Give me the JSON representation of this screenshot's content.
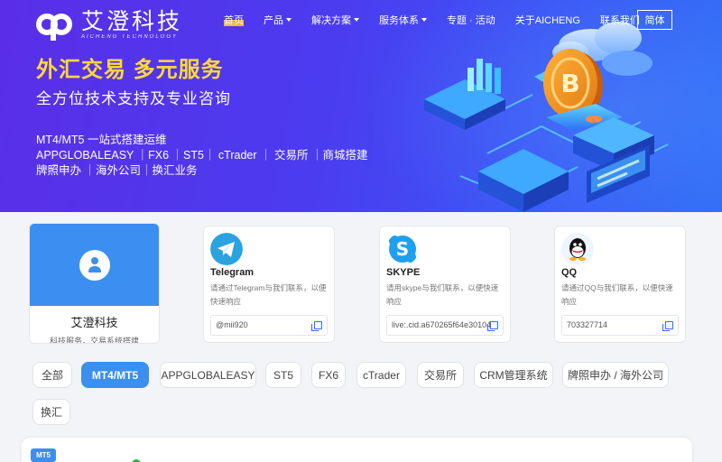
{
  "brand": {
    "name_cn": "艾澄科技",
    "name_en": "AICHENG TECHNOLOGY"
  },
  "nav": {
    "items": [
      {
        "label": "首页",
        "dropdown": false,
        "active": true
      },
      {
        "label": "产品",
        "dropdown": true
      },
      {
        "label": "解决方案",
        "dropdown": true
      },
      {
        "label": "服务体系",
        "dropdown": true
      },
      {
        "label": "专题 · 活动",
        "dropdown": false
      },
      {
        "label": "关于AICHENG",
        "dropdown": false
      },
      {
        "label": "联系我们",
        "dropdown": false
      }
    ],
    "lang_button": "简体"
  },
  "hero": {
    "title": "外汇交易 多元服务",
    "subtitle": "全方位技术支持及专业咨询",
    "line1": "MT4/MT5 一站式搭建运维",
    "line2": " APPGLOBALEASY ｜FX6 ｜ST5｜ cTrader ｜ 交易所 ｜商城搭建",
    "line3": " 牌照申办 ｜海外公司｜换汇业务"
  },
  "profile": {
    "name": "艾澄科技",
    "desc": "科技服务，交易系统搭建"
  },
  "contacts": [
    {
      "title": "Telegram",
      "desc": "请通过Telegram与我们联系，以便快速响应",
      "value": "@mii920",
      "icon": "telegram-icon",
      "color": "#2aa3e0"
    },
    {
      "title": "SKYPE",
      "desc": "请用skype与我们联系，以便快速响应",
      "value": "live:.cid.a670265f64e30104",
      "icon": "skype-icon",
      "color": "#1fa0ef"
    },
    {
      "title": "QQ",
      "desc": "请通过QQ与我们联系，以便快速响应",
      "value": "703327714",
      "icon": "qq-icon",
      "color": "#111111"
    }
  ],
  "filters": [
    {
      "label": "全部"
    },
    {
      "label": "MT4/MT5",
      "active": true
    },
    {
      "label": "APPGLOBALEASY"
    },
    {
      "label": "ST5"
    },
    {
      "label": "FX6"
    },
    {
      "label": "cTrader"
    },
    {
      "label": "交易所"
    },
    {
      "label": "CRM管理系统"
    },
    {
      "label": "牌照申办 / 海外公司"
    },
    {
      "label": "换汇"
    }
  ],
  "panel": {
    "badge": "MT5"
  },
  "colors": {
    "accent": "#3b8ff0",
    "hero_title": "#ffd83b",
    "nav_highlight": "#f4b53f"
  }
}
